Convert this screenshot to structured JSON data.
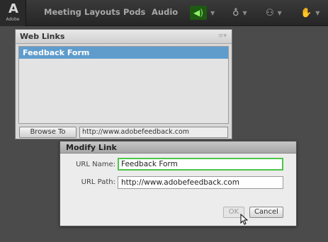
{
  "menubar": {
    "logo": {
      "mark": "A",
      "word": "Adobe"
    },
    "items": [
      "Meeting",
      "Layouts",
      "Pods",
      "Audio"
    ],
    "tools": {
      "speaker_icon": "speaker-icon",
      "mic_icon": "microphone-icon",
      "camera_icon": "webcam-icon",
      "hand_icon": "raise-hand-icon",
      "speaker_active_color": "#1e5a12"
    }
  },
  "pod": {
    "title": "Web Links",
    "menu_icon": "pod-menu-icon",
    "links": [
      {
        "name": "Feedback Form"
      }
    ],
    "browse_label": "Browse To",
    "url_value": "http://www.adobefeedback.com",
    "selected_color": "#5f9ccc"
  },
  "dialog": {
    "title": "Modify Link",
    "name_label": "URL Name:",
    "name_value": "Feedback Form",
    "path_label": "URL Path:",
    "path_value": "http://www.adobefeedback.com",
    "ok_label": "OK",
    "cancel_label": "Cancel",
    "focus_color": "#4cc64a"
  }
}
